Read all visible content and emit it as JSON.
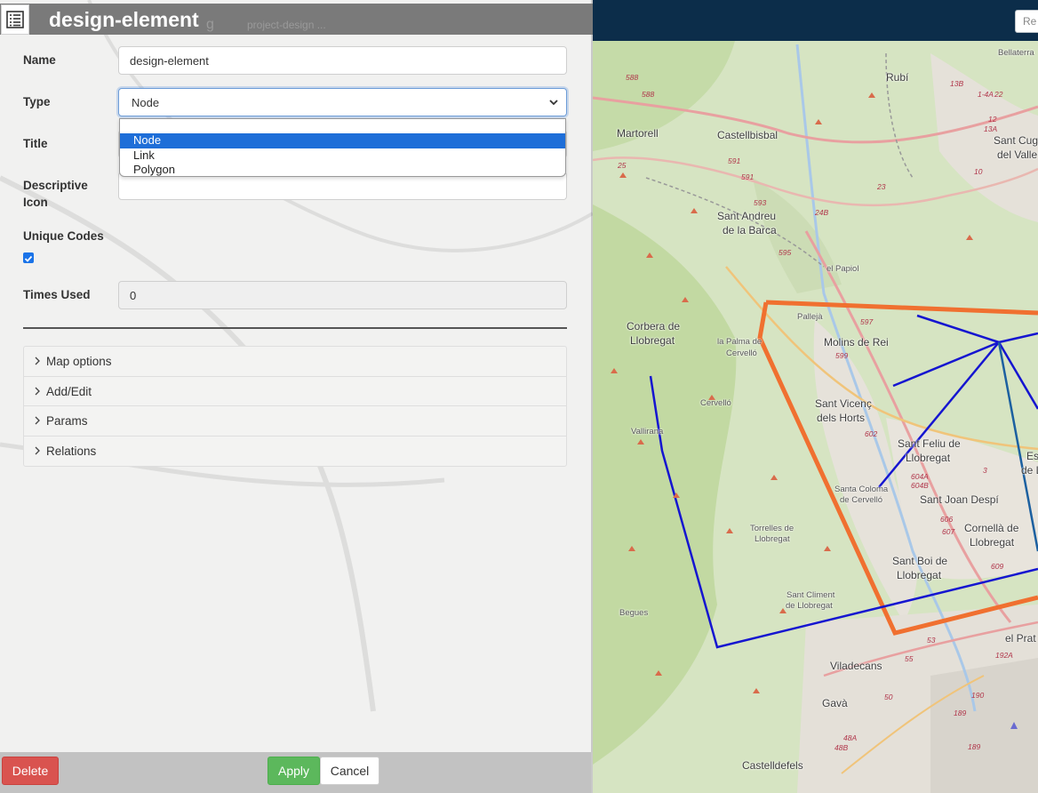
{
  "header": {
    "title": "design-element",
    "ghost_text_1": "g",
    "ghost_text_2": "project-design ..."
  },
  "form": {
    "name_label": "Name",
    "name_value": "design-element",
    "type_label": "Type",
    "type_value": "Node",
    "type_options": [
      "Node",
      "Link",
      "Polygon"
    ],
    "title_label": "Title",
    "icon_label_line1": "Descriptive",
    "icon_label_line2": "Icon",
    "unique_codes_label": "Unique Codes",
    "unique_codes_checked": true,
    "times_used_label": "Times Used",
    "times_used_value": "0"
  },
  "accordion": [
    "Map options",
    "Add/Edit",
    "Params",
    "Relations"
  ],
  "footer": {
    "delete": "Delete",
    "apply": "Apply",
    "cancel": "Cancel"
  },
  "colors": {
    "header": "#7a7a7a",
    "delete": "#d9534f",
    "apply": "#5cb85c",
    "polygon": "#f07030",
    "links": "#1515d0",
    "map_topbar": "#0c2d4a"
  },
  "map": {
    "search_text": "Re",
    "places": [
      "Bellaterra",
      "Rubí",
      "Martorell",
      "Castellbisbal",
      "Sant Cug",
      "del Valle",
      "Sant Andreu",
      "de la Barca",
      "el Papiol",
      "Pallejà",
      "Corbera de",
      "Llobregat",
      "la Palma de",
      "Cervelló",
      "Molins de Rei",
      "Sant Vicenç",
      "dels Horts",
      "Cervelló",
      "Vallirana",
      "Sant Feliu de",
      "Llobregat",
      "Esp",
      "de Ll",
      "Santa Coloma",
      "de Cervelló",
      "Sant Joan Despí",
      "Cornellà de",
      "Llobregat",
      "Torrelles de",
      "Llobregat",
      "Sant Boi de",
      "Llobregat",
      "Sant Climent",
      "de Llobregat",
      "Begues",
      "el Prat",
      "Viladecans",
      "Gavà",
      "Castelldefels"
    ],
    "road_numbers": [
      "588",
      "588",
      "13B",
      "1-4A",
      "22",
      "12",
      "13A",
      "10",
      "25",
      "591",
      "591",
      "593",
      "23",
      "24B",
      "595",
      "597",
      "599",
      "602",
      "604A",
      "604B",
      "3",
      "606",
      "607",
      "609",
      "53",
      "55",
      "50",
      "48A",
      "48B",
      "192A",
      "190",
      "189",
      "189"
    ]
  }
}
